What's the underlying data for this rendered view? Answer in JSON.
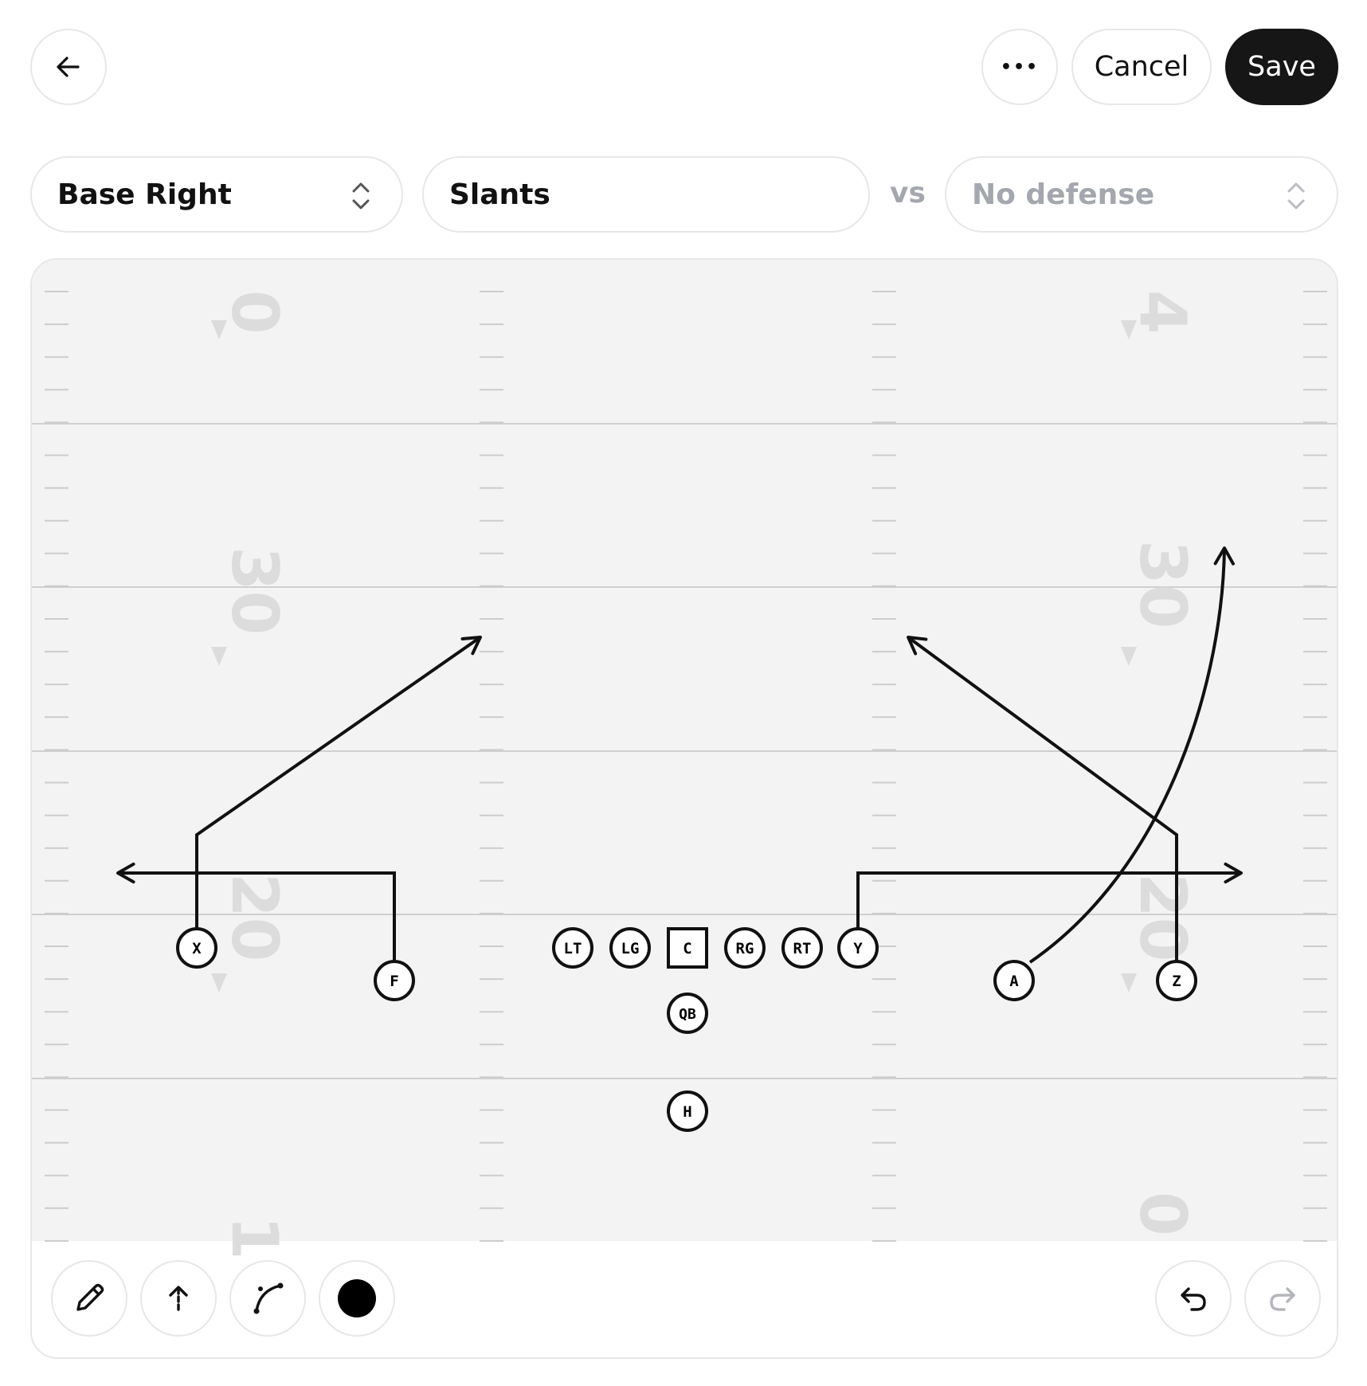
{
  "header": {
    "more_label": "•••",
    "cancel_label": "Cancel",
    "save_label": "Save"
  },
  "selectors": {
    "formation": "Base Right",
    "play_name": "Slants",
    "vs_label": "vs",
    "defense_placeholder": "No defense"
  },
  "field": {
    "yard_numbers": [
      "0",
      "4",
      "30",
      "30",
      "20",
      "20",
      "1",
      "0"
    ],
    "players": [
      {
        "id": "X",
        "label": "X"
      },
      {
        "id": "F",
        "label": "F"
      },
      {
        "id": "LT",
        "label": "LT"
      },
      {
        "id": "LG",
        "label": "LG"
      },
      {
        "id": "C",
        "label": "C"
      },
      {
        "id": "RG",
        "label": "RG"
      },
      {
        "id": "RT",
        "label": "RT"
      },
      {
        "id": "Y",
        "label": "Y"
      },
      {
        "id": "A",
        "label": "A"
      },
      {
        "id": "Z",
        "label": "Z"
      },
      {
        "id": "QB",
        "label": "QB"
      },
      {
        "id": "H",
        "label": "H"
      }
    ]
  },
  "toolbar": {
    "tools": [
      "pencil-tool",
      "route-tool",
      "curve-tool",
      "color-tool"
    ],
    "active_color": "#000000",
    "history": [
      "undo",
      "redo"
    ]
  },
  "colors": {
    "field_background": "#f3f3f3",
    "save_background": "#161616",
    "border": "#e6e7ea",
    "muted_text": "#a4a7ad"
  }
}
